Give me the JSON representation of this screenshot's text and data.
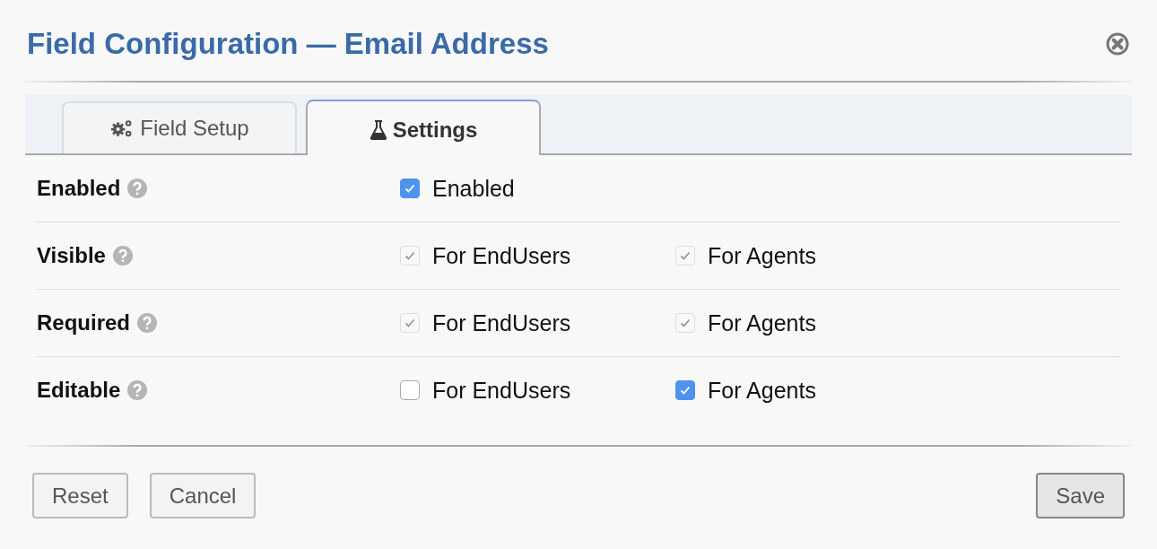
{
  "dialog": {
    "title": "Field Configuration — Email Address"
  },
  "tabs": [
    {
      "label": "Field Setup",
      "selected": false
    },
    {
      "label": "Settings",
      "selected": true
    }
  ],
  "rows": [
    {
      "label": "Enabled",
      "options": [
        {
          "label": "Enabled",
          "checked": true,
          "disabled": false
        }
      ]
    },
    {
      "label": "Visible",
      "options": [
        {
          "label": "For EndUsers",
          "checked": true,
          "disabled": true
        },
        {
          "label": "For Agents",
          "checked": true,
          "disabled": true
        }
      ]
    },
    {
      "label": "Required",
      "options": [
        {
          "label": "For EndUsers",
          "checked": true,
          "disabled": true
        },
        {
          "label": "For Agents",
          "checked": true,
          "disabled": true
        }
      ]
    },
    {
      "label": "Editable",
      "options": [
        {
          "label": "For EndUsers",
          "checked": false,
          "disabled": false
        },
        {
          "label": "For Agents",
          "checked": true,
          "disabled": false
        }
      ]
    }
  ],
  "buttons": {
    "left": [
      "Reset",
      "Cancel"
    ],
    "right": [
      "Save"
    ]
  }
}
